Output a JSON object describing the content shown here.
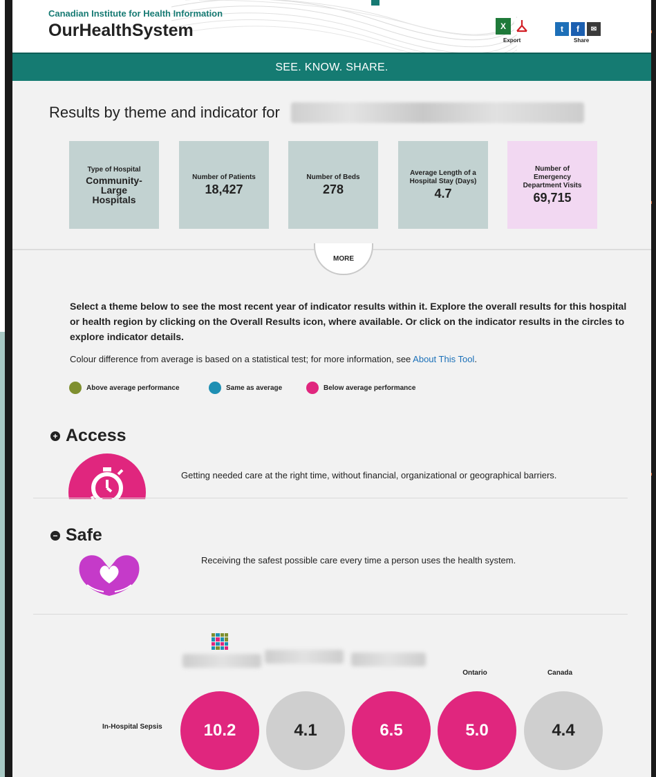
{
  "header": {
    "institute": "Canadian Institute for Health Information",
    "brand": "OurHealthSystem",
    "export_label": "Export",
    "share_label": "Share",
    "excel_glyph": "X",
    "twitter_glyph": "t",
    "facebook_glyph": "f",
    "email_glyph": "✉",
    "icons": [
      "excel-icon",
      "pdf-icon",
      "twitter-icon",
      "facebook-icon",
      "email-icon"
    ]
  },
  "tagline": "SEE. KNOW. SHARE.",
  "results": {
    "title": "Results by theme and indicator for"
  },
  "cards": [
    {
      "label": "Type of Hospital",
      "value": "Community-\nLarge\nHospitals"
    },
    {
      "label": "Number of Patients",
      "value": "18,427"
    },
    {
      "label": "Number of Beds",
      "value": "278"
    },
    {
      "label": "Average Length of a Hospital Stay (Days)",
      "value": "4.7"
    },
    {
      "label": "Number of Emergency Department Visits",
      "value": "69,715"
    }
  ],
  "more_label": "MORE",
  "intro_text": "Select a theme below to see the most recent year of indicator results within it. Explore the overall results for this hospital or health region by clicking on the Overall Results icon, where available. Or click on the indicator results in the circles to explore indicator details.",
  "note": {
    "text": "Colour difference from average is based on a statistical test; for more information, see ",
    "link": "About This Tool",
    "end": "."
  },
  "legend": [
    {
      "label": "Above average performance",
      "color": "#7f8f2f"
    },
    {
      "label": "Same as average",
      "color": "#1e8fb3"
    },
    {
      "label": "Below average performance",
      "color": "#e0267e"
    }
  ],
  "themes": {
    "access": {
      "title": "Access",
      "toggle": "+",
      "description": "Getting needed care at the right time, without financial, organizational or geographical barriers."
    },
    "safe": {
      "title": "Safe",
      "toggle": "−",
      "description": "Receiving the safest possible care every time a person uses the health system."
    }
  },
  "comparison": {
    "columns": [
      "Ontario",
      "Canada"
    ],
    "indicator": "In-Hospital Sepsis",
    "values": [
      "10.2",
      "4.1",
      "6.5",
      "5.0",
      "4.4"
    ],
    "statuses": [
      "below",
      "same-grey",
      "below",
      "below",
      "same-grey"
    ]
  },
  "colors": {
    "brand_teal": "#157b72",
    "below_pink": "#e0267e",
    "neutral_grey": "#cfcfcf",
    "card_teal": "#c2d2d1",
    "card_pink": "#f2d8f2",
    "link_blue": "#1b70b8"
  }
}
